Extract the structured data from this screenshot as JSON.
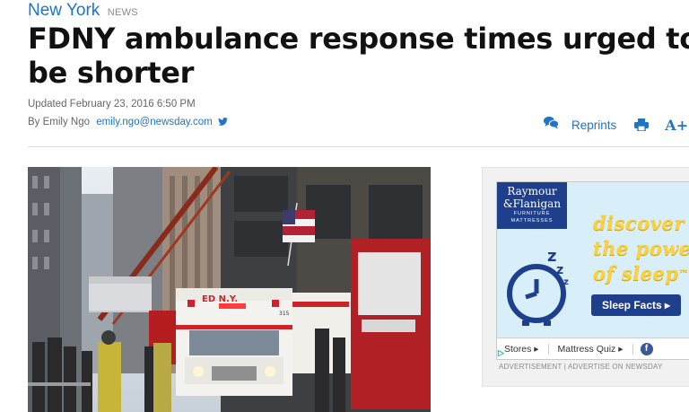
{
  "section": {
    "name": "New York",
    "sub": "NEWS"
  },
  "article": {
    "headline": "FDNY ambulance response times urged to be shorter",
    "updated": "Updated February 23, 2016 6:50 PM",
    "byline_prefix": "By Emily Ngo",
    "author_email": "emily.ngo@newsday.com"
  },
  "tools": {
    "reprints": "Reprints",
    "font_size": "A+"
  },
  "photo": {
    "ambulance_lettering": "ED N.Y.",
    "unit_number": "315"
  },
  "ad": {
    "brand_line1": "Raymour",
    "brand_line2": "&Flanigan",
    "brand_line3": "FURNITURE",
    "brand_line4": "MATTRESSES",
    "slogan_line1": "discover",
    "slogan_line2": "the power",
    "slogan_line3": "of sleep",
    "trademark": "™",
    "cta": "Sleep Facts ▸",
    "bar_stores": "Stores ▸",
    "bar_quiz": "Mattress Quiz ▸",
    "bar_fb": "f",
    "label": "ADVERTISEMENT | ADVERTISE ON NEWSDAY"
  },
  "colors": {
    "link": "#1f74c6",
    "ad_navy": "#1e3f8c",
    "ad_yellow": "#fbd13d"
  }
}
